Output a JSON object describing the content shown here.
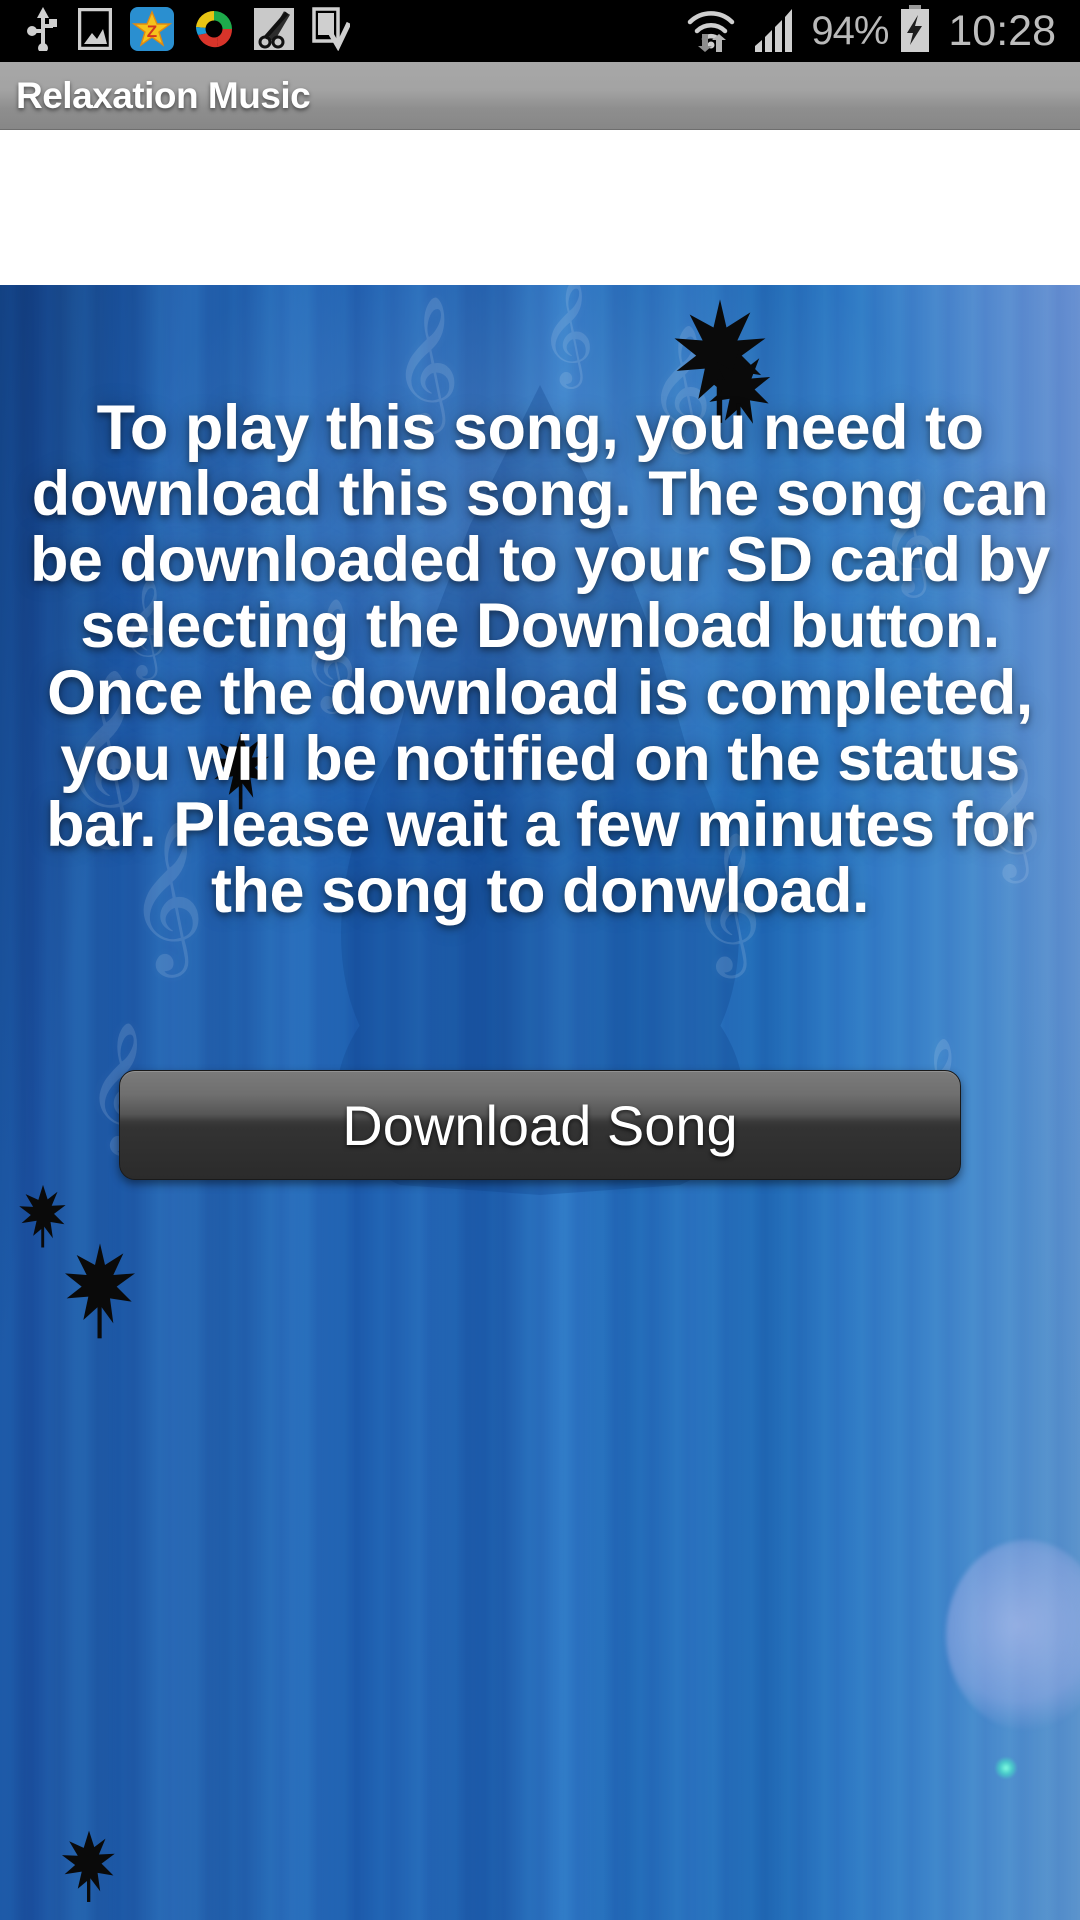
{
  "statusbar": {
    "left_icons": [
      "usb-icon",
      "screenshot-image-icon",
      "zedge-star-app-icon",
      "colorful-circle-app-icon",
      "scissors-clip-icon",
      "download-complete-device-icon"
    ],
    "right_icons": [
      "wifi-data-transfer-icon",
      "cellular-signal-icon",
      "battery-charging-icon"
    ],
    "battery_percent": "94%",
    "clock": "10:28"
  },
  "titlebar": {
    "title": "Relaxation Music"
  },
  "content": {
    "message": "To play this song, you need to download this song. The song can be downloaded to your SD card by selecting the Download button. Once the download is completed, you will be notified on the status bar. Please wait a few minutes for the song to donwload.",
    "download_button_label": "Download Song",
    "background": {
      "theme": "blue-curtain-with-treble-clefs-and-leaf-silhouettes",
      "accent_blue": "#2a6cb8",
      "bokeh_color": "#bec3f0",
      "glow_dot_color": "#82ffe1"
    }
  }
}
